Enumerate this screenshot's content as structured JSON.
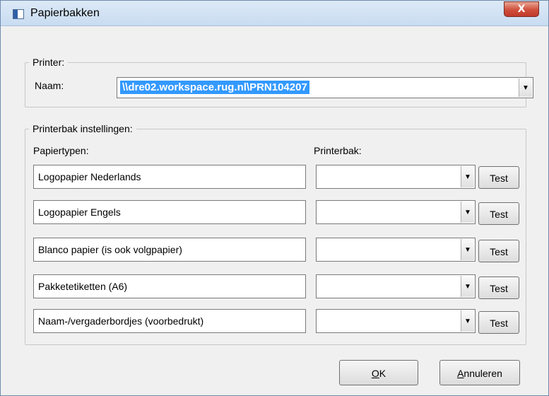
{
  "window": {
    "title": "Papierbakken",
    "close_label": "X"
  },
  "printer_group": {
    "legend": "Printer:",
    "name_label": "Naam:",
    "selected_printer": "\\\\dre02.workspace.rug.nl\\PRN104207"
  },
  "tray_group": {
    "legend": "Printerbak instellingen:",
    "paper_types_header": "Papiertypen:",
    "tray_header": "Printerbak:",
    "rows": [
      {
        "paper_type": "Logopapier Nederlands",
        "tray": "",
        "test_label": "Test"
      },
      {
        "paper_type": "Logopapier Engels",
        "tray": "",
        "test_label": "Test"
      },
      {
        "paper_type": "Blanco papier (is ook volgpapier)",
        "tray": "",
        "test_label": "Test"
      },
      {
        "paper_type": "Pakketetiketten (A6)",
        "tray": "",
        "test_label": "Test"
      },
      {
        "paper_type": "Naam-/vergaderbordjes (voorbedrukt)",
        "tray": "",
        "test_label": "Test"
      }
    ]
  },
  "footer": {
    "ok_mnemonic": "O",
    "ok_rest": "K",
    "cancel_mnemonic": "A",
    "cancel_rest": "nnuleren"
  },
  "icons": {
    "dropdown": "chevron-down-icon",
    "close": "close-icon",
    "app": "window-app-icon"
  }
}
